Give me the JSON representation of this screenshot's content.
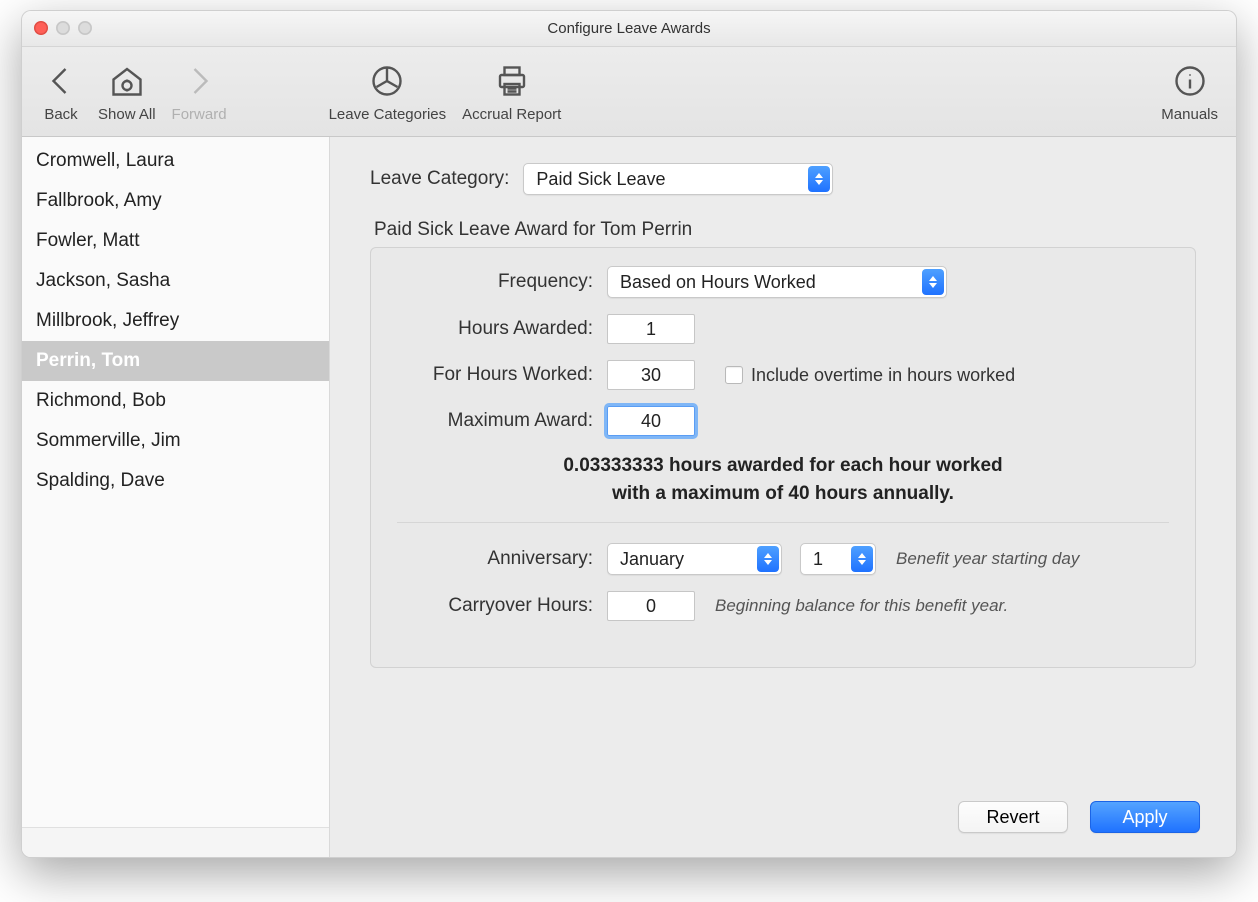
{
  "window": {
    "title": "Configure Leave Awards"
  },
  "toolbar": {
    "back": "Back",
    "show_all": "Show All",
    "forward": "Forward",
    "leave_categories": "Leave Categories",
    "accrual_report": "Accrual Report",
    "manuals": "Manuals"
  },
  "sidebar": {
    "items": [
      {
        "name": "Cromwell, Laura",
        "selected": false
      },
      {
        "name": "Fallbrook, Amy",
        "selected": false
      },
      {
        "name": "Fowler, Matt",
        "selected": false
      },
      {
        "name": "Jackson, Sasha",
        "selected": false
      },
      {
        "name": "Millbrook, Jeffrey",
        "selected": false
      },
      {
        "name": "Perrin, Tom",
        "selected": true
      },
      {
        "name": "Richmond, Bob",
        "selected": false
      },
      {
        "name": "Sommerville, Jim",
        "selected": false
      },
      {
        "name": "Spalding, Dave",
        "selected": false
      }
    ]
  },
  "main": {
    "leave_category_label": "Leave Category:",
    "leave_category_value": "Paid Sick Leave",
    "group_title": "Paid Sick Leave Award for Tom Perrin",
    "frequency_label": "Frequency:",
    "frequency_value": "Based on Hours Worked",
    "hours_awarded_label": "Hours Awarded:",
    "hours_awarded_value": "1",
    "for_hours_worked_label": "For Hours Worked:",
    "for_hours_worked_value": "30",
    "include_overtime_label": "Include overtime in hours worked",
    "include_overtime_checked": false,
    "max_award_label": "Maximum Award:",
    "max_award_value": "40",
    "summary_line1": "0.03333333 hours awarded for each hour worked",
    "summary_line2": "with a maximum of 40 hours annually.",
    "anniversary_label": "Anniversary:",
    "anniversary_month": "January",
    "anniversary_day": "1",
    "anniversary_hint": "Benefit year starting day",
    "carryover_label": "Carryover Hours:",
    "carryover_value": "0",
    "carryover_hint": "Beginning balance for this benefit year."
  },
  "buttons": {
    "revert": "Revert",
    "apply": "Apply"
  }
}
